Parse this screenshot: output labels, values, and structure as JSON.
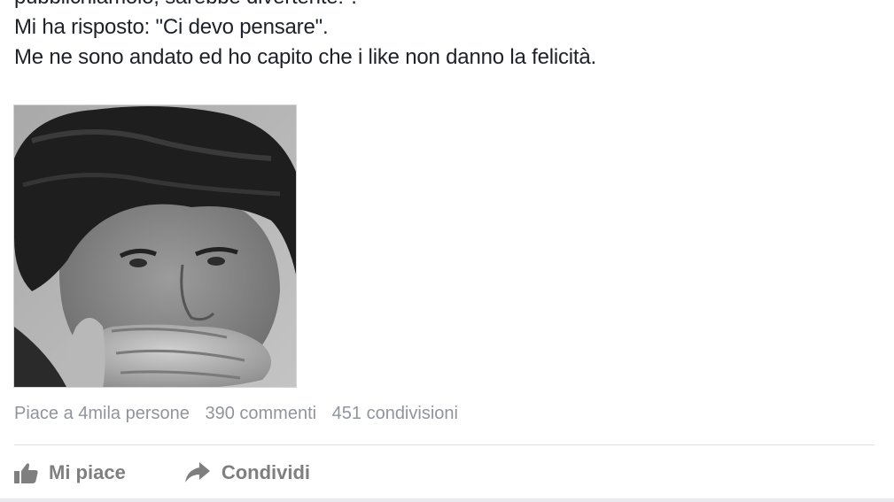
{
  "post": {
    "text_lines": [
      "pubblichiamolo, sarebbe divertente!\".",
      "Mi ha risposto: \"Ci devo pensare\".",
      "Me ne sono andato ed ho capito che i like non danno la felicità."
    ]
  },
  "stats": {
    "likes": "Piace a 4mila persone",
    "comments": "390 commenti",
    "shares": "451 condivisioni"
  },
  "actions": {
    "like_label": "Mi piace",
    "share_label": "Condividi"
  },
  "icons": {
    "like": "thumbs-up-icon",
    "share": "share-arrow-icon"
  },
  "colors": {
    "text": "#1d2129",
    "muted": "#90949c",
    "action": "#7f7f7f",
    "divider": "#dddfe2"
  }
}
